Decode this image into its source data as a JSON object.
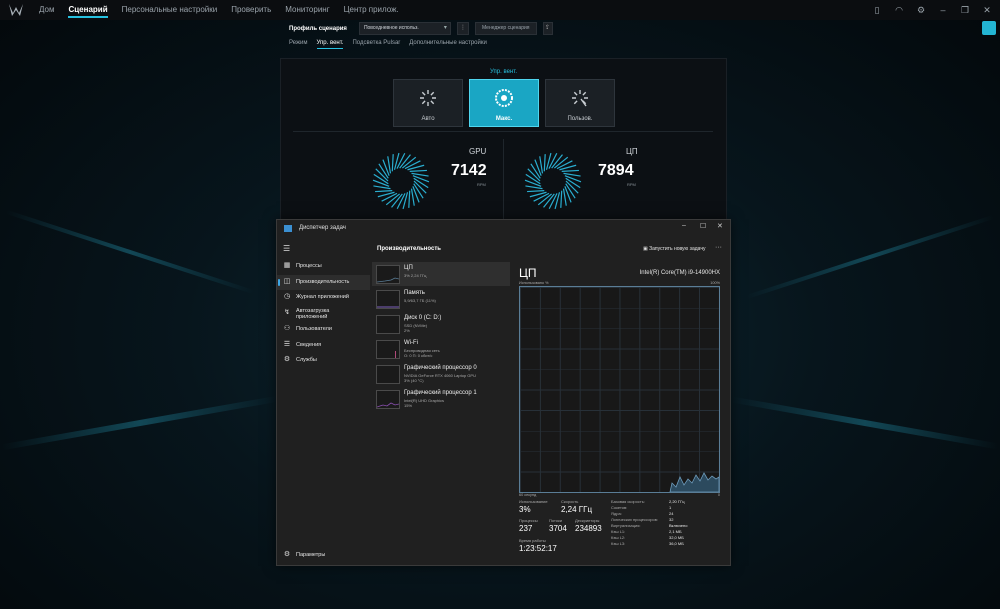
{
  "nav": {
    "items": [
      "Дом",
      "Сценарий",
      "Персональные настройки",
      "Проверить",
      "Мониторинг",
      "Центр прилож."
    ],
    "active_index": 1
  },
  "scenario": {
    "profile_label": "Профиль сценария",
    "profile_value": "Повседневное использ.",
    "manager_label": "Менеджер сценария",
    "tabs": [
      "Режим",
      "Упр. вент.",
      "Подсветка Pulsar",
      "Дополнительные настройки"
    ],
    "active_tab_index": 1
  },
  "fan_control": {
    "title": "Упр. вент.",
    "modes": [
      "Авто",
      "Макс.",
      "Пользов."
    ],
    "active_mode_index": 1,
    "gpu": {
      "label": "GPU",
      "rpm": "7142",
      "unit": "RPM"
    },
    "cpu": {
      "label": "ЦП",
      "rpm": "7894",
      "unit": "RPM"
    }
  },
  "task_manager": {
    "title": "Диспетчер задач",
    "nav": [
      "Процессы",
      "Производительность",
      "Журнал приложений",
      "Автозагрузка приложений",
      "Пользователи",
      "Сведения",
      "Службы"
    ],
    "active_nav_index": 1,
    "settings": "Параметры",
    "section_title": "Производительность",
    "run_task": "Запустить новую задачу",
    "devices": [
      {
        "name": "ЦП",
        "sub": "3% 2,24 ГГц",
        "sub2": ""
      },
      {
        "name": "Память",
        "sub": "5,9/63,7 ГБ (11%)",
        "sub2": ""
      },
      {
        "name": "Диск 0 (C: D:)",
        "sub": "SSD (NVMe)",
        "sub2": "2%"
      },
      {
        "name": "Wi-Fi",
        "sub": "Беспроводная сеть",
        "sub2": "О: 0 П: 0 кбит/с"
      },
      {
        "name": "Графический процессор 0",
        "sub": "NVIDIA GeForce RTX 4060 Laptop GPU",
        "sub2": "3% (40 °C)"
      },
      {
        "name": "Графический процессор 1",
        "sub": "Intel(R) UHD Graphics",
        "sub2": "15%"
      }
    ],
    "cpu": {
      "heading": "ЦП",
      "model": "Intel(R) Core(TM) i9-14900HX",
      "axis_top_left": "Использовано %",
      "axis_top_right": "100%",
      "axis_bottom_left": "60 секунд",
      "axis_bottom_right": "0",
      "utilization_label": "Использование",
      "utilization": "3%",
      "speed_label": "Скорость",
      "speed": "2,24 ГГц",
      "processes_label": "Процессы",
      "processes": "237",
      "threads_label": "Потоки",
      "threads": "3704",
      "handles_label": "Дескрипторы",
      "handles": "234893",
      "uptime_label": "Время работы",
      "uptime": "1:23:52:17",
      "details": [
        {
          "k": "Базовая скорость:",
          "v": "2,20 ГГц"
        },
        {
          "k": "Сокетов:",
          "v": "1"
        },
        {
          "k": "Ядра:",
          "v": "24"
        },
        {
          "k": "Логических процессоров:",
          "v": "32"
        },
        {
          "k": "Виртуализация:",
          "v": "Включено"
        },
        {
          "k": "Кэш L1:",
          "v": "2,1 МБ"
        },
        {
          "k": "Кэш L2:",
          "v": "32,0 МБ"
        },
        {
          "k": "Кэш L3:",
          "v": "36,0 МБ"
        }
      ]
    }
  },
  "colors": {
    "accent": "#27c1e0",
    "graph_line": "#5a7d96"
  }
}
